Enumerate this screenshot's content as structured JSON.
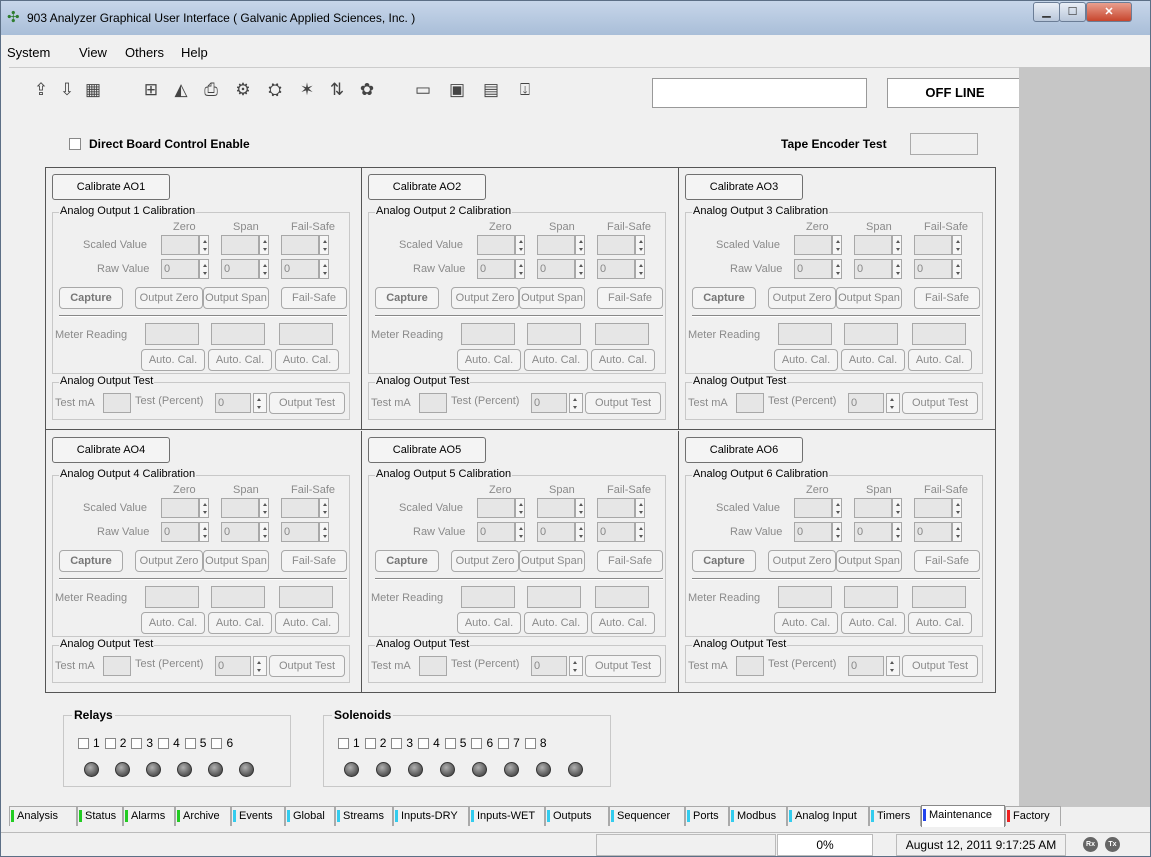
{
  "window": {
    "title": "903 Analyzer Graphical User Interface  ( Galvanic Applied Sciences, Inc. )"
  },
  "menu": [
    "System",
    "View",
    "Others",
    "Help"
  ],
  "toolbar": {
    "status_text": "",
    "offline": "OFF LINE"
  },
  "main": {
    "direct_board_control": "Direct Board Control Enable",
    "tape_encoder_label": "Tape Encoder Test",
    "tape_encoder_value": ""
  },
  "calibration": {
    "col_zero": "Zero",
    "col_span": "Span",
    "col_failsafe": "Fail-Safe",
    "scaled_value": "Scaled Value",
    "raw_value": "Raw Value",
    "raw_default": "0",
    "capture": "Capture",
    "output_zero": "Output Zero",
    "output_span": "Output Span",
    "fail_safe": "Fail-Safe",
    "meter_reading": "Meter Reading",
    "auto_cal": "Auto. Cal.",
    "test_group": "Analog Output Test",
    "test_ma": "Test mA",
    "test_percent": "Test (Percent)",
    "test_percent_value": "0",
    "output_test": "Output Test",
    "panels": [
      {
        "button": "Calibrate AO1",
        "group": "Analog Output 1 Calibration"
      },
      {
        "button": "Calibrate AO2",
        "group": "Analog Output 2 Calibration"
      },
      {
        "button": "Calibrate AO3",
        "group": "Analog Output 3 Calibration"
      },
      {
        "button": "Calibrate AO4",
        "group": "Analog Output 4 Calibration"
      },
      {
        "button": "Calibrate AO5",
        "group": "Analog Output 5 Calibration"
      },
      {
        "button": "Calibrate AO6",
        "group": "Analog Output 6 Calibration"
      }
    ]
  },
  "relays": {
    "label": "Relays",
    "items": [
      "1",
      "2",
      "3",
      "4",
      "5",
      "6"
    ]
  },
  "solenoids": {
    "label": "Solenoids",
    "items": [
      "1",
      "2",
      "3",
      "4",
      "5",
      "6",
      "7",
      "8"
    ]
  },
  "tabs": [
    {
      "label": "Analysis",
      "color": "#22cc22"
    },
    {
      "label": "Status",
      "color": "#22cc22"
    },
    {
      "label": "Alarms",
      "color": "#22cc22"
    },
    {
      "label": "Archive",
      "color": "#22cc22"
    },
    {
      "label": "Events",
      "color": "#33ccee"
    },
    {
      "label": "Global",
      "color": "#33ccee"
    },
    {
      "label": "Streams",
      "color": "#33ccee"
    },
    {
      "label": "Inputs-DRY",
      "color": "#33ccee"
    },
    {
      "label": "Inputs-WET",
      "color": "#33ccee"
    },
    {
      "label": "Outputs",
      "color": "#33ccee"
    },
    {
      "label": "Sequencer",
      "color": "#33ccee"
    },
    {
      "label": "Ports",
      "color": "#33ccee"
    },
    {
      "label": "Modbus",
      "color": "#33ccee"
    },
    {
      "label": "Analog Input",
      "color": "#33ccee"
    },
    {
      "label": "Timers",
      "color": "#33ccee"
    },
    {
      "label": "Maintenance",
      "color": "#2244ee",
      "selected": true
    },
    {
      "label": "Factory",
      "color": "#ee2222"
    }
  ],
  "status": {
    "progress": "0%",
    "datetime": "August 12, 2011 9:17:25 AM",
    "rx": "Rx",
    "tx": "Tx"
  }
}
